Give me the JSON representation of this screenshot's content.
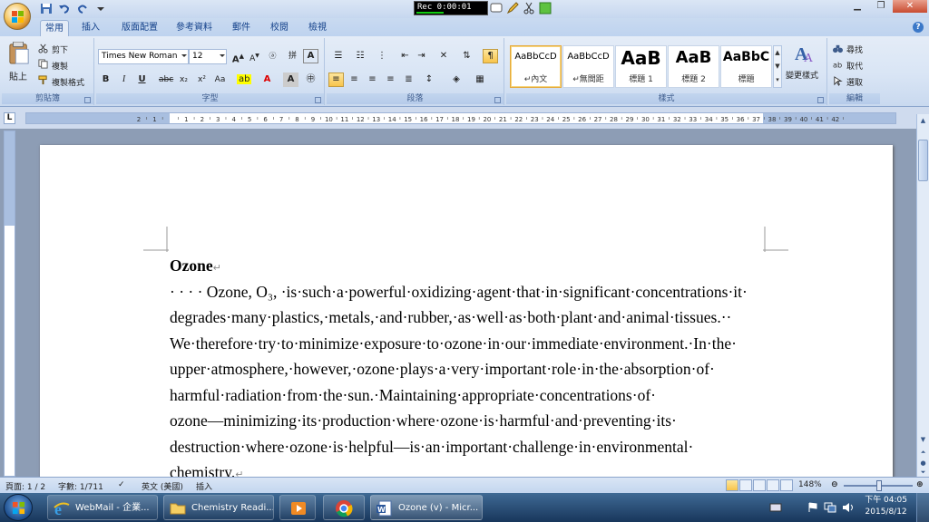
{
  "recorder": {
    "time": "Rec 0:00:01"
  },
  "tabs": [
    {
      "label": "常用"
    },
    {
      "label": "插入"
    },
    {
      "label": "版面配置"
    },
    {
      "label": "參考資料"
    },
    {
      "label": "郵件"
    },
    {
      "label": "校閱"
    },
    {
      "label": "檢視"
    }
  ],
  "clipboard": {
    "paste": "貼上",
    "cut": "剪下",
    "copy": "複製",
    "format_painter": "複製格式",
    "label": "剪貼簿"
  },
  "font": {
    "name": "Times New Roman",
    "size": "12",
    "label": "字型"
  },
  "paragraph": {
    "label": "段落"
  },
  "styles": {
    "label": "樣式",
    "items": [
      {
        "sample": "AaBbCcD",
        "name": "↵內文"
      },
      {
        "sample": "AaBbCcD",
        "name": "↵無間距"
      },
      {
        "sample": "AaB",
        "name": "標題 1"
      },
      {
        "sample": "AaB",
        "name": "標題 2"
      },
      {
        "sample": "AaBbC",
        "name": "標題"
      }
    ],
    "change_styles": "變更樣式"
  },
  "editing": {
    "label": "編輯",
    "find": "尋找",
    "replace": "取代",
    "select": "選取"
  },
  "ruler_numbers": [
    "2",
    "1",
    "",
    "1",
    "2",
    "3",
    "4",
    "5",
    "6",
    "7",
    "8",
    "9",
    "10",
    "11",
    "12",
    "13",
    "14",
    "15",
    "16",
    "17",
    "18",
    "19",
    "20",
    "21",
    "22",
    "23",
    "24",
    "25",
    "26",
    "27",
    "28",
    "29",
    "30",
    "31",
    "32",
    "33",
    "34",
    "35",
    "36",
    "37",
    "38",
    "39",
    "40",
    "41",
    "42"
  ],
  "document": {
    "title": "Ozone",
    "lines": [
      "· · · ·  Ozone, O₃, ·is·such·a·powerful·oxidizing·agent·that·in·significant·concentrations·it·",
      "degrades·many·plastics,·metals,·and·rubber,·as·well·as·both·plant·and·animal·tissues.··",
      "We·therefore·try·to·minimize·exposure·to·ozone·in·our·immediate·environment.·In·the·",
      "upper·atmosphere,·however,·ozone·plays·a·very·important·role·in·the·absorption·of·",
      "harmful·radiation·from·the·sun.·Maintaining·appropriate·concentrations·of·",
      "ozone—minimizing·its·production·where·ozone·is·harmful·and·preventing·its·",
      "destruction·where·ozone·is·helpful—is·an·important·challenge·in·environmental·",
      "chemistry."
    ]
  },
  "status": {
    "page": "頁面: 1 / 2",
    "words": "字數: 1/711",
    "language": "英文 (美國)",
    "mode": "插入",
    "zoom": "148%"
  },
  "taskbar": {
    "items": [
      {
        "label": "WebMail - 企業..."
      },
      {
        "label": "Chemistry Readi..."
      },
      {
        "label": ""
      },
      {
        "label": ""
      },
      {
        "label": "Ozone (v) - Micr..."
      }
    ],
    "time": "下午 04:05",
    "date": "2015/8/12"
  }
}
